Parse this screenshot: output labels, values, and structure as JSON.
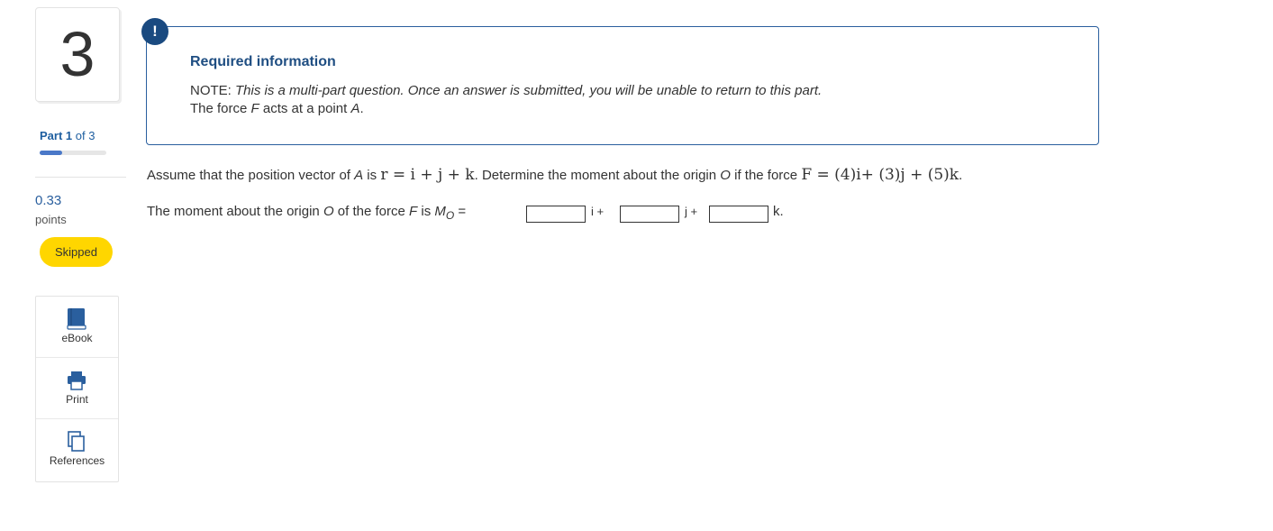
{
  "question": {
    "number": "3"
  },
  "sidebar": {
    "part_bold": "Part 1",
    "part_rest": " of 3",
    "progress_fraction": 0.333,
    "points_value": "0.33",
    "points_label": "points",
    "status_badge": "Skipped",
    "tools": [
      {
        "label": "eBook",
        "icon": "book-icon"
      },
      {
        "label": "Print",
        "icon": "printer-icon"
      },
      {
        "label": "References",
        "icon": "references-icon"
      }
    ]
  },
  "info": {
    "alert_symbol": "!",
    "title": "Required information",
    "note_prefix": "NOTE: ",
    "note_text": "This is a multi-part question. Once an answer is submitted, you will be unable to return to this part.",
    "line2_a": "The force ",
    "line2_F": "F",
    "line2_b": " acts at a point ",
    "line2_A": "A",
    "line2_c": "."
  },
  "problem": {
    "s1": "Assume that the position vector of ",
    "A": "A",
    "s2": " is ",
    "r_expr": "r = i + j + k",
    "s3": ". Determine the moment about the origin ",
    "O": "O",
    "s4": " if the force ",
    "F_expr": "F = (4)i+ (3)j + (5)k",
    "s5": "."
  },
  "answer": {
    "p1": "The moment about the origin ",
    "O": "O",
    "p2": " of the force ",
    "F": "F",
    "p3": " is ",
    "M": "M",
    "sub": "O",
    "eq": " =",
    "unit_i": "i +",
    "unit_j": "j +",
    "unit_k": "k.",
    "inputs": [
      "",
      "",
      ""
    ]
  },
  "colors": {
    "accent": "#1a4a80",
    "badge": "#ffd600",
    "link": "#1f5fa0"
  }
}
